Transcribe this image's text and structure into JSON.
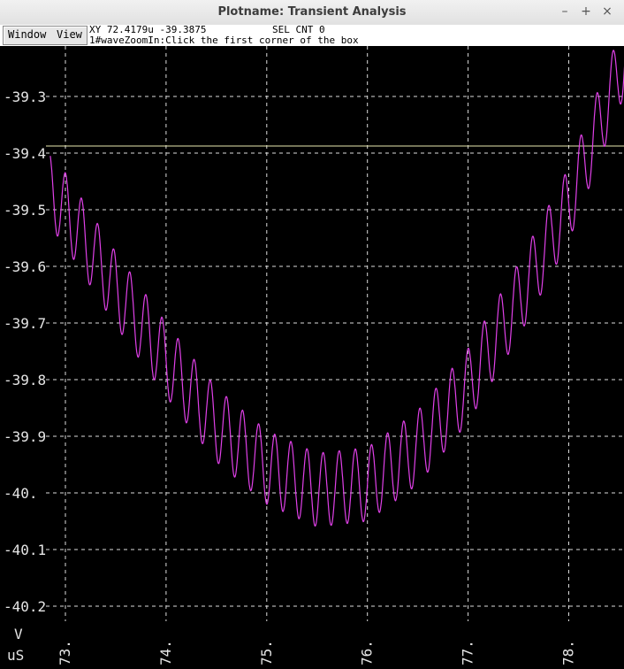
{
  "window": {
    "title": "Plotname: Transient Analysis",
    "controls": {
      "minimize": "–",
      "maximize": "+",
      "close": "×"
    }
  },
  "toolbar": {
    "window_label": "Window",
    "view_label": "View",
    "coordinates": "XY 72.4179u -39.3875",
    "sel_count": "SEL CNT 0",
    "status": "1#waveZoomIn:Click the first corner of the box"
  },
  "colors": {
    "background": "#000000",
    "grid": "#dcdcdc",
    "trace": "#e040e8",
    "cursor_line": "#e8e8b0",
    "text": "#e6e6e6"
  },
  "chart_data": {
    "type": "line",
    "xlabel": "uS",
    "ylabel": "V",
    "xlim": [
      72.85,
      78.6
    ],
    "ylim": [
      -40.25,
      -39.22
    ],
    "x_ticks": [
      73,
      74,
      75,
      76,
      77,
      78
    ],
    "x_tick_labels": [
      "73.",
      "74.",
      "75.",
      "76.",
      "77.",
      "78."
    ],
    "y_ticks": [
      -39.3,
      -39.4,
      -39.5,
      -39.6,
      -39.7,
      -39.8,
      -39.9,
      -40.0,
      -40.1,
      -40.2
    ],
    "y_tick_labels": [
      "-39.3",
      "-39.4",
      "-39.5",
      "-39.6",
      "-39.7",
      "-39.8",
      "-39.9",
      "-40.",
      "-40.1",
      "-40.2"
    ],
    "grid": true,
    "cursor_y": -39.3875,
    "series": [
      {
        "oscillation": {
          "period_us": 0.16,
          "amplitude_v": 0.065
        },
        "center_curve": {
          "x": [
            72.85,
            73.0,
            73.5,
            74.0,
            74.5,
            75.0,
            75.5,
            76.0,
            76.5,
            77.0,
            77.5,
            78.0,
            78.6
          ],
          "y": [
            -39.465,
            -39.5,
            -39.64,
            -39.765,
            -39.88,
            -39.955,
            -39.995,
            -39.985,
            -39.92,
            -39.81,
            -39.66,
            -39.49,
            -39.21
          ]
        }
      }
    ]
  }
}
